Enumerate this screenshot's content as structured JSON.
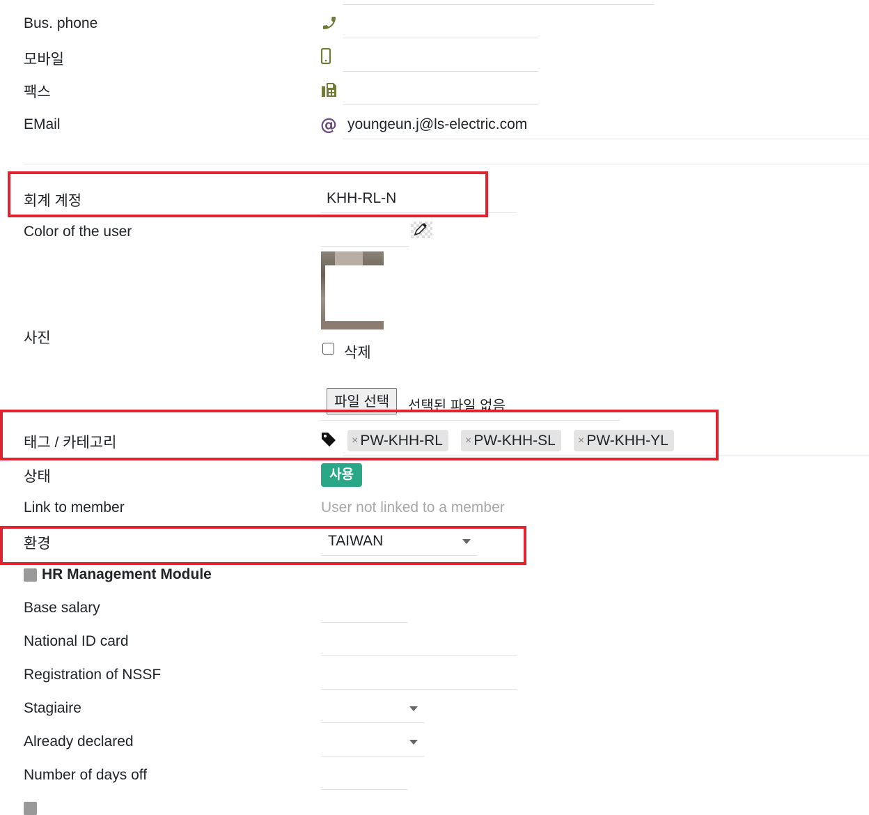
{
  "contact": {
    "bus_phone_label": "Bus. phone",
    "mobile_label": "모바일",
    "fax_label": "팩스",
    "email_label": "EMail",
    "email_value": "youngeun.j@ls-electric.com"
  },
  "account": {
    "label": "회계 계정",
    "value": "KHH-RL-N"
  },
  "color": {
    "label": "Color of the user"
  },
  "photo": {
    "label": "사진",
    "delete_label": "삭제",
    "file_button": "파일 선택",
    "file_status": "선택된 파일 없음"
  },
  "tags": {
    "label": "태그 / 카테고리",
    "items": [
      "PW-KHH-RL",
      "PW-KHH-SL",
      "PW-KHH-YL"
    ],
    "remove_symbol": "×"
  },
  "status": {
    "label": "상태",
    "value": "사용",
    "color": "#2aa786"
  },
  "member": {
    "label": "Link to member",
    "value": "User not linked to a member"
  },
  "environment": {
    "label": "환경",
    "value": "TAIWAN"
  },
  "hr": {
    "section_title": "HR Management Module",
    "base_salary_label": "Base salary",
    "national_id_label": "National ID card",
    "nssf_label": "Registration of NSSF",
    "stagiaire_label": "Stagiaire",
    "already_declared_label": "Already declared",
    "days_off_label": "Number of days off"
  },
  "icons": {
    "phone": "phone-icon",
    "mobile": "mobile-icon",
    "fax": "fax-icon",
    "email": "at-icon",
    "tag": "tag-icon",
    "color_picker": "pencil-icon"
  },
  "accent": {
    "icon_color": "#707a3a",
    "email_icon_color": "#6b4a7a",
    "highlight_color": "#e0242f"
  }
}
